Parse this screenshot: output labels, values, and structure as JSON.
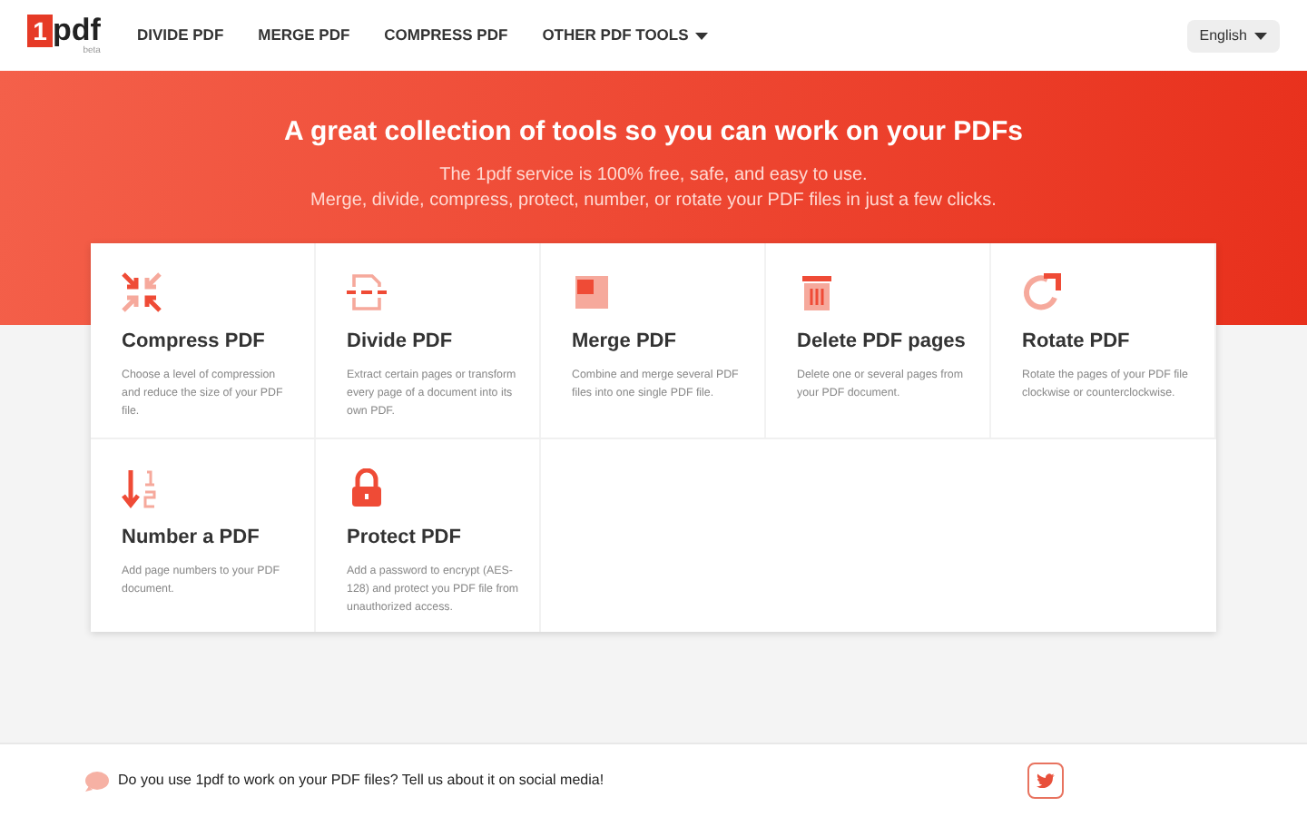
{
  "logo": {
    "digit": "1",
    "text": "pdf",
    "tag": "beta"
  },
  "nav": [
    {
      "label": "DIVIDE PDF",
      "dropdown": false
    },
    {
      "label": "MERGE PDF",
      "dropdown": false
    },
    {
      "label": "COMPRESS PDF",
      "dropdown": false
    },
    {
      "label": "OTHER PDF TOOLS",
      "dropdown": true
    }
  ],
  "language": {
    "label": "English"
  },
  "hero": {
    "title": "A great collection of tools so you can work on your PDFs",
    "lines": [
      "The 1pdf service is 100% free, safe, and easy to use.",
      "Merge, divide, compress, protect, number, or rotate your PDF files in just a few clicks."
    ]
  },
  "tools": [
    {
      "kind": "compress",
      "title": "Compress PDF",
      "description": "Choose a level of compression and reduce the size of your PDF file."
    },
    {
      "kind": "divide",
      "title": "Divide PDF",
      "description": "Extract certain pages or transform every page of a document into its own PDF."
    },
    {
      "kind": "merge",
      "title": "Merge PDF",
      "description": "Combine and merge several PDF files into one single PDF file."
    },
    {
      "kind": "delete",
      "title": "Delete PDF pages",
      "description": "Delete one or several pages from your PDF document."
    },
    {
      "kind": "rotate",
      "title": "Rotate PDF",
      "description": "Rotate the pages of your PDF file clockwise or counterclockwise."
    },
    {
      "kind": "number",
      "title": "Number a PDF",
      "description": "Add page numbers to your PDF document."
    },
    {
      "kind": "protect",
      "title": "Protect PDF",
      "description": "Add a password to encrypt (AES-128) and protect you PDF file from unauthorized access."
    }
  ],
  "footer": {
    "text": "Do you use 1pdf to work on your PDF files? Tell us about it on social media!"
  }
}
